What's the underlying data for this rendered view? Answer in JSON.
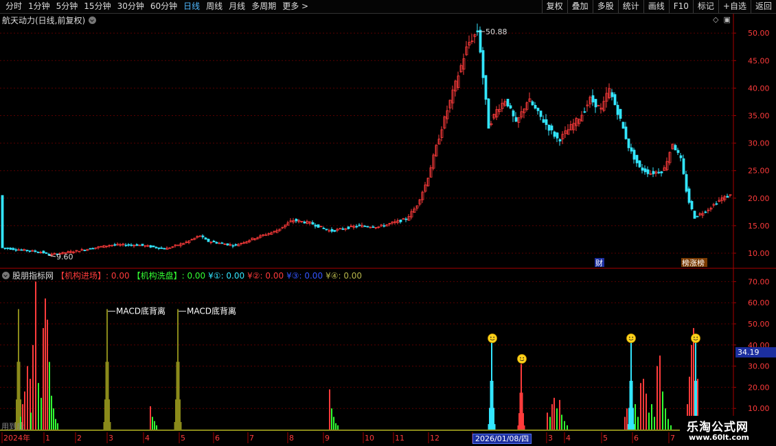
{
  "toolbar": {
    "periods": [
      "分时",
      "1分钟",
      "5分钟",
      "15分钟",
      "30分钟",
      "60分钟",
      "日线",
      "周线",
      "月线",
      "多周期",
      "更多 >"
    ],
    "active_period": "日线",
    "tools": [
      "复权",
      "叠加",
      "多股",
      "统计",
      "画线",
      "F10",
      "标记",
      "+自选",
      "返回"
    ]
  },
  "stock": {
    "title": "航天动力(日线,前复权)"
  },
  "indicator": {
    "name": "股朋指标网",
    "items": [
      {
        "label": "【机构进场】: 0.00",
        "color": "#ff3b3b"
      },
      {
        "label": "【机构洗盘】: 0.00",
        "color": "#33ff33"
      },
      {
        "label": "¥①: 0.00",
        "color": "#33e6ff"
      },
      {
        "label": "¥②: 0.00",
        "color": "#ff3b3b"
      },
      {
        "label": "¥③: 0.00",
        "color": "#3355ff"
      },
      {
        "label": "¥④: 0.00",
        "color": "#b5b54a"
      }
    ],
    "cursor_value": "34.19",
    "annotations": [
      "MACD底背离",
      "MACD底背离"
    ]
  },
  "price_axis": [
    "50.00",
    "45.00",
    "40.00",
    "35.00",
    "30.00",
    "25.00",
    "20.00",
    "15.00",
    "10.00"
  ],
  "indicator_axis": [
    "70.00",
    "60.00",
    "50.00",
    "40.00",
    "30.00",
    "20.00",
    "10.00"
  ],
  "price_marks": {
    "high": "50.88",
    "low": "9.60"
  },
  "event_labels": {
    "fin": "财",
    "board": "榜涨榜"
  },
  "time_axis": [
    "2024年",
    "1",
    "2",
    "3",
    "4",
    "5",
    "6",
    "7",
    "8",
    "9",
    "10",
    "11",
    "12",
    "1",
    "3",
    "4",
    "5",
    "6",
    "7"
  ],
  "cursor_date": "2026/01/08/四",
  "bottom_left": "用到后",
  "watermark": {
    "line1": "乐淘公式网",
    "line2": "www.60lt.com"
  },
  "colors": {
    "up": "#ff3b3b",
    "down": "#33e6ff",
    "grid": "#5a0000",
    "axis": "#aa0000",
    "olive": "#8a8a1a"
  }
}
